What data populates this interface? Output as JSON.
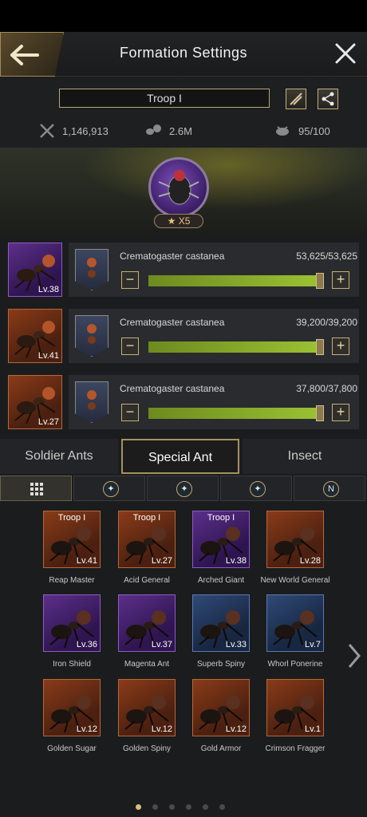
{
  "header": {
    "title": "Formation Settings"
  },
  "troop": {
    "name": "Troop I",
    "stats": [
      {
        "icon": "crossed-swords-icon",
        "value": "1,146,913"
      },
      {
        "icon": "ant-load-icon",
        "value": "2.6M"
      },
      {
        "icon": "insect-capacity-icon",
        "value": "95/100"
      }
    ]
  },
  "hero": {
    "star_badge": "★ X5"
  },
  "ants": [
    {
      "level": "Lv.38",
      "portrait_color": "purple",
      "name": "Crematogaster castanea",
      "count": "53,625/53,625",
      "fill": 0.98
    },
    {
      "level": "Lv.41",
      "portrait_color": "bronze",
      "name": "Crematogaster castanea",
      "count": "39,200/39,200",
      "fill": 0.98
    },
    {
      "level": "Lv.27",
      "portrait_color": "bronze",
      "name": "Crematogaster castanea",
      "count": "37,800/37,800",
      "fill": 0.98
    }
  ],
  "tabs": [
    {
      "label": "Soldier Ants",
      "active": false
    },
    {
      "label": "Special Ant",
      "active": true
    },
    {
      "label": "Insect",
      "active": false
    }
  ],
  "filters": [
    {
      "icon": "grid-icon",
      "active": true
    },
    {
      "icon": "ant-type-1-icon",
      "active": false
    },
    {
      "icon": "ant-type-2-icon",
      "active": false
    },
    {
      "icon": "ant-type-3-icon",
      "active": false
    },
    {
      "icon": "letter-n-icon",
      "active": false,
      "text": "N"
    }
  ],
  "cards": [
    {
      "name": "Reap Master",
      "level": "Lv.41",
      "troop": "Troop I",
      "color": "bronze"
    },
    {
      "name": "Acid General",
      "level": "Lv.27",
      "troop": "Troop I",
      "color": "bronze"
    },
    {
      "name": "Arched Giant",
      "level": "Lv.38",
      "troop": "Troop I",
      "color": "purple"
    },
    {
      "name": "New World General",
      "level": "Lv.28",
      "troop": "",
      "color": "bronze"
    },
    {
      "name": "Iron Shield",
      "level": "Lv.36",
      "troop": "",
      "color": "purple"
    },
    {
      "name": "Magenta Ant",
      "level": "Lv.37",
      "troop": "",
      "color": "purple"
    },
    {
      "name": "Superb Spiny",
      "level": "Lv.33",
      "troop": "",
      "color": "blue"
    },
    {
      "name": "Whorl Ponerine",
      "level": "Lv.7",
      "troop": "",
      "color": "blue"
    },
    {
      "name": "Golden Sugar",
      "level": "Lv.12",
      "troop": "",
      "color": "bronze"
    },
    {
      "name": "Golden Spiny",
      "level": "Lv.12",
      "troop": "",
      "color": "bronze"
    },
    {
      "name": "Gold Armor",
      "level": "Lv.12",
      "troop": "",
      "color": "bronze"
    },
    {
      "name": "Crimson Fragger",
      "level": "Lv.1",
      "troop": "",
      "color": "bronze"
    }
  ],
  "pagination": {
    "pages": 6,
    "current": 1
  }
}
